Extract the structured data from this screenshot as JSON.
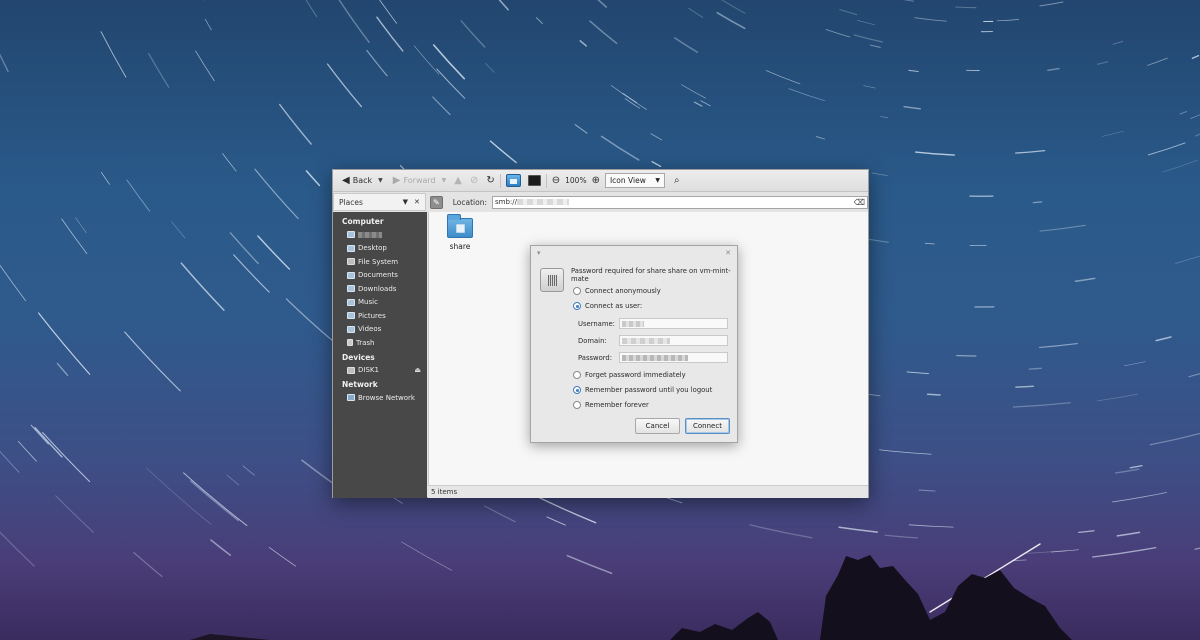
{
  "toolbar": {
    "back_label": "Back",
    "forward_label": "Forward",
    "zoom_level": "100%",
    "view_mode": "Icon View"
  },
  "location": {
    "places_label": "Places",
    "label": "Location:",
    "value_prefix": "smb://"
  },
  "sidebar": {
    "computer_heading": "Computer",
    "computer_items": [
      "Desktop",
      "File System",
      "Documents",
      "Downloads",
      "Music",
      "Pictures",
      "Videos",
      "Trash"
    ],
    "devices_heading": "Devices",
    "device_items": [
      "DISK1"
    ],
    "network_heading": "Network",
    "network_items": [
      "Browse Network"
    ]
  },
  "content": {
    "folder_name": "share",
    "status": "5 items"
  },
  "dialog": {
    "message": "Password required for share share on vm-mint-mate",
    "connect_anonymously": "Connect anonymously",
    "connect_as_user": "Connect as user:",
    "username_label": "Username:",
    "domain_label": "Domain:",
    "password_label": "Password:",
    "forget_immediately": "Forget password immediately",
    "remember_until_logout": "Remember password until you logout",
    "remember_forever": "Remember forever",
    "cancel_label": "Cancel",
    "connect_label": "Connect"
  },
  "colors": {
    "sidebar_bg": "#484848",
    "accent": "#3f7cbf"
  }
}
